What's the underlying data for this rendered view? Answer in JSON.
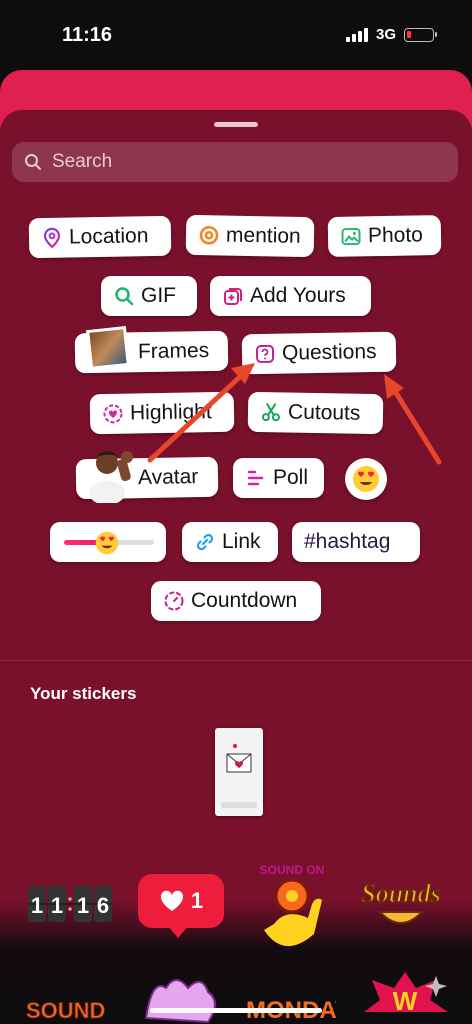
{
  "status": {
    "time": "11:16",
    "network": "3G"
  },
  "search": {
    "placeholder": "Search"
  },
  "stickers": {
    "location": "Location",
    "mention": "mention",
    "photo": "Photo",
    "gif": "GIF",
    "add_yours": "Add Yours",
    "frames": "Frames",
    "questions": "Questions",
    "highlight": "Highlight",
    "cutouts": "Cutouts",
    "avatar": "Avatar",
    "poll": "Poll",
    "link": "Link",
    "hashtag": "#hashtag",
    "countdown": "Countdown"
  },
  "your_stickers": {
    "title": "Your stickers"
  },
  "gallery": {
    "clock": [
      "1",
      "1",
      "1",
      "6"
    ],
    "like_count": "1",
    "sound_on": "SOUND ON",
    "sounds": "Sounds",
    "row2_left": "SOUND ON!",
    "row2_mid": "MONDAY"
  },
  "colors": {
    "accent": "#e0204f",
    "sheet": "#79102c",
    "annotation_arrow": "#e8462a"
  }
}
